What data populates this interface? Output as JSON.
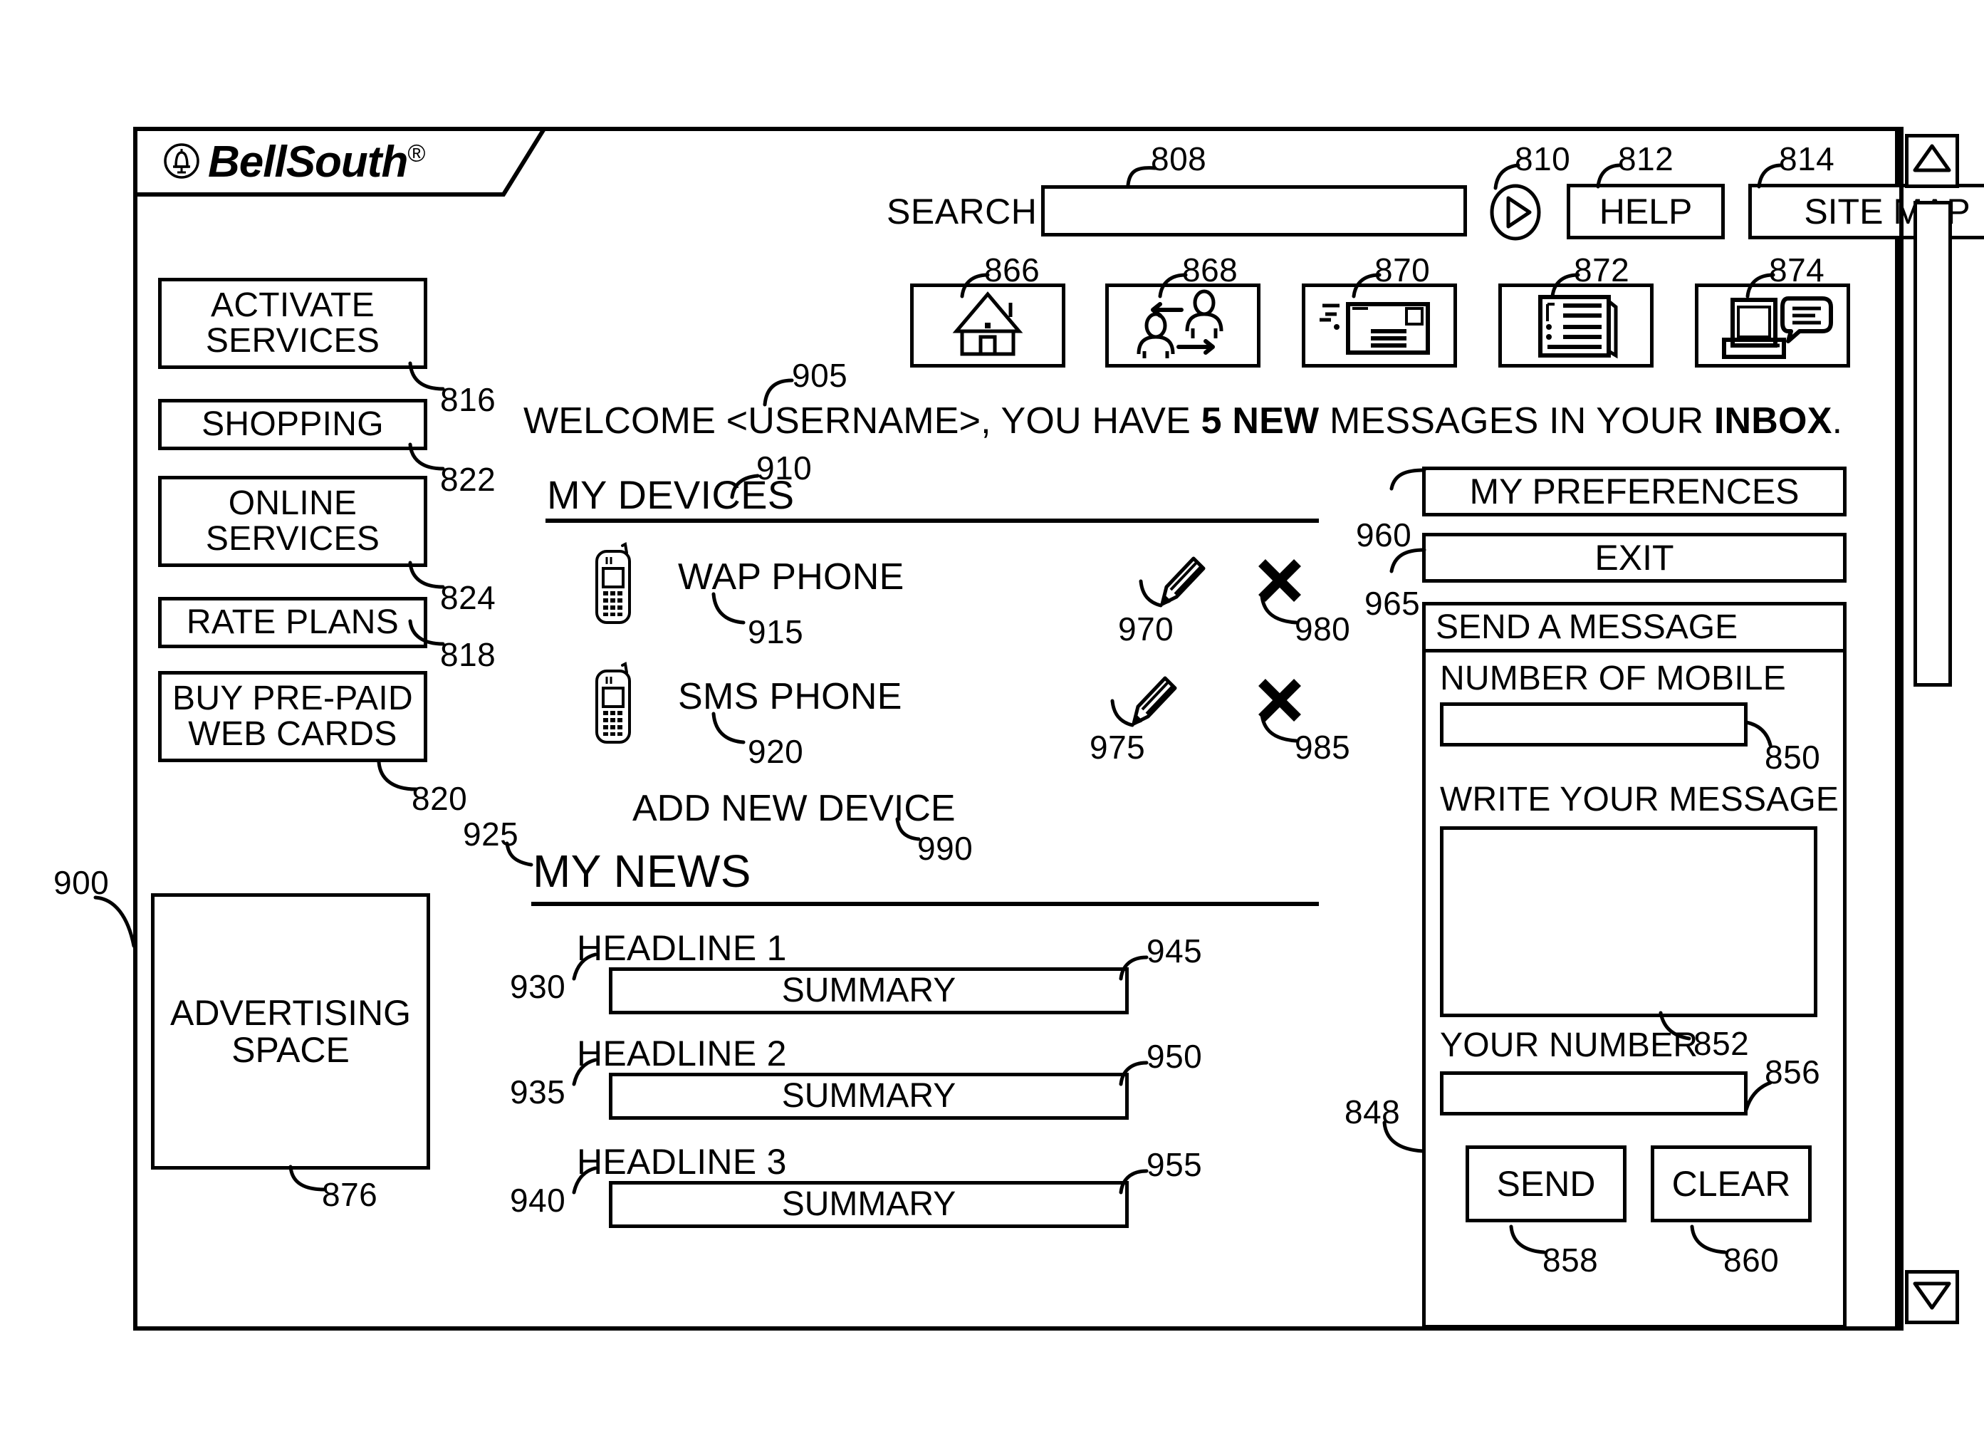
{
  "figure": {
    "ref_900": "900"
  },
  "logo": {
    "brand": "BellSouth",
    "registered": "®",
    "mark": "bell-in-circle-icon"
  },
  "search": {
    "label": "SEARCH",
    "input_value": "",
    "input_ref": "808",
    "go_icon": "play-triangle-icon",
    "go_ref": "810",
    "help_label": "HELP",
    "help_ref": "812",
    "sitemap_label": "SITE MAP",
    "sitemap_ref": "814"
  },
  "nav_icons": [
    {
      "icon": "house-icon",
      "ref": "866"
    },
    {
      "icon": "two-people-arrows-icon",
      "ref": "868"
    },
    {
      "icon": "envelope-icon",
      "ref": "870"
    },
    {
      "icon": "document-list-icon",
      "ref": "872"
    },
    {
      "icon": "computer-chat-icon",
      "ref": "874"
    }
  ],
  "sidebar": {
    "items": [
      {
        "label": "ACTIVATE SERVICES",
        "ref": "816"
      },
      {
        "label": "SHOPPING",
        "ref": "822"
      },
      {
        "label": "ONLINE SERVICES",
        "ref": "824"
      },
      {
        "label": "RATE PLANS",
        "ref": "818"
      },
      {
        "label": "BUY PRE-PAID WEB CARDS",
        "ref": "820"
      }
    ],
    "advertising": {
      "line1": "ADVERTISING",
      "line2": "SPACE",
      "ref": "876"
    }
  },
  "welcome": {
    "prefix": "WELCOME <USERNAME>, YOU HAVE ",
    "count": "5 NEW",
    "middle": " MESSAGES IN YOUR ",
    "inbox": "INBOX",
    "suffix": ".",
    "ref": "905"
  },
  "my_devices": {
    "title": "MY DEVICES",
    "ref": "910",
    "devices": [
      {
        "name": "WAP PHONE",
        "name_ref": "915",
        "icon": "mobile-phone-icon",
        "edit_icon": "pencil-icon",
        "edit_ref": "970",
        "delete_icon": "x-icon",
        "delete_ref": "980"
      },
      {
        "name": "SMS PHONE",
        "name_ref": "920",
        "icon": "mobile-phone-icon",
        "edit_icon": "pencil-icon",
        "edit_ref": "975",
        "delete_icon": "x-icon",
        "delete_ref": "985"
      }
    ],
    "add_new_label": "ADD NEW DEVICE",
    "add_new_ref": "990"
  },
  "my_news": {
    "title": "MY NEWS",
    "ref": "925",
    "items": [
      {
        "headline": "HEADLINE 1",
        "headline_ref": "930",
        "summary": "SUMMARY",
        "summary_ref": "945"
      },
      {
        "headline": "HEADLINE 2",
        "headline_ref": "935",
        "summary": "SUMMARY",
        "summary_ref": "950"
      },
      {
        "headline": "HEADLINE 3",
        "headline_ref": "940",
        "summary": "SUMMARY",
        "summary_ref": "955"
      }
    ]
  },
  "right_panel": {
    "my_preferences_label": "MY PREFERENCES",
    "exit_label": "EXIT",
    "exit_ref": "960",
    "send_message": {
      "title": "SEND A MESSAGE",
      "panel_ref": "965",
      "panel_border_ref": "848",
      "mobile_number_label": "NUMBER OF MOBILE",
      "mobile_number_value": "",
      "mobile_number_ref": "850",
      "message_label": "WRITE YOUR MESSAGE",
      "message_value": "",
      "message_ref": "852",
      "your_number_label": "YOUR NUMBER",
      "your_number_value": "",
      "your_number_ref": "856",
      "send_label": "SEND",
      "send_ref": "858",
      "clear_label": "CLEAR",
      "clear_ref": "860"
    }
  },
  "scrollbar": {
    "up_icon": "triangle-up-icon",
    "down_icon": "triangle-down-icon",
    "thumb": "scrollbar-thumb"
  }
}
